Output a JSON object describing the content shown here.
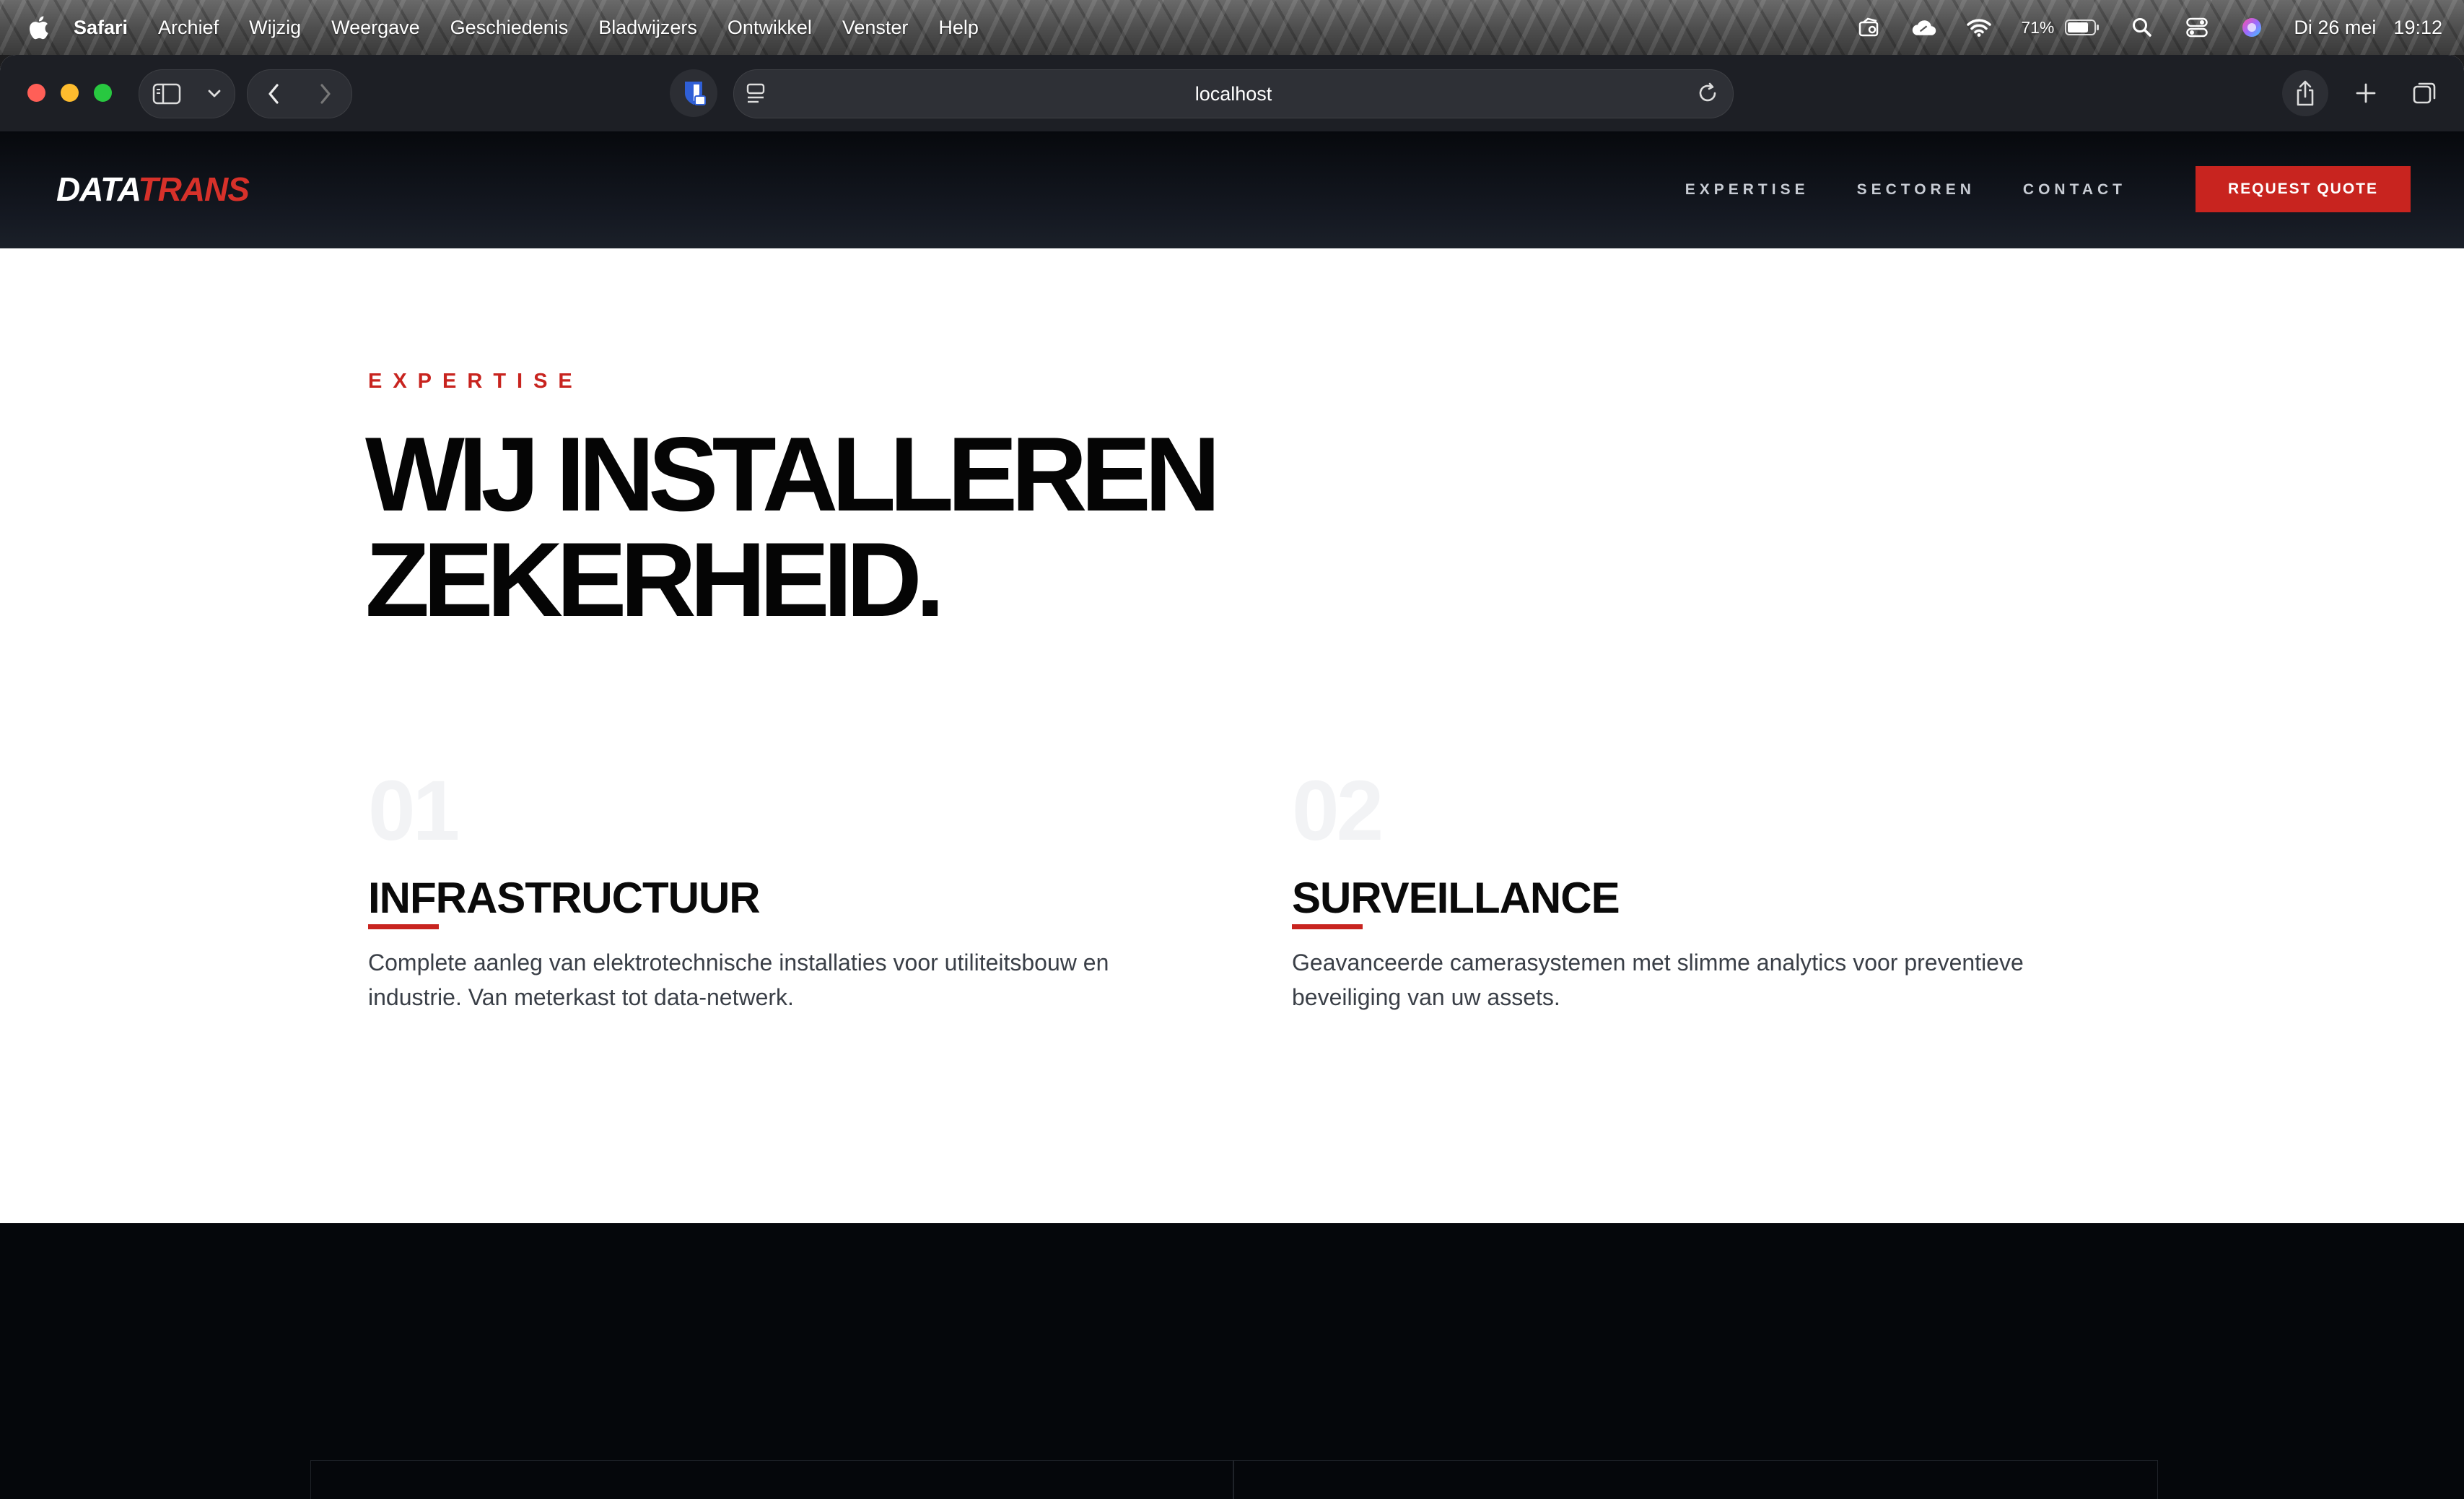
{
  "menubar": {
    "app_name": "Safari",
    "items": [
      "Archief",
      "Wijzig",
      "Weergave",
      "Geschiedenis",
      "Bladwijzers",
      "Ontwikkel",
      "Venster",
      "Help"
    ],
    "battery": "71%",
    "date": "Di 26 mei",
    "time": "19:12"
  },
  "browser": {
    "url": "localhost"
  },
  "site": {
    "logo_part1": "DATA",
    "logo_part2": "TRANS",
    "nav": [
      "EXPERTISE",
      "SECTOREN",
      "CONTACT"
    ],
    "cta": "REQUEST QUOTE",
    "colors": {
      "accent": "#c8241f",
      "dark": "#05070b",
      "header": "#141821"
    }
  },
  "expertise": {
    "eyebrow": "EXPERTISE",
    "headline_line1": "WIJ INSTALLEREN",
    "headline_line2": "ZEKERHEID.",
    "cards": [
      {
        "number": "01",
        "title": "INFRASTRUCTUUR",
        "description": "Complete aanleg van elektrotechnische installaties voor utiliteitsbouw en industrie. Van meterkast tot data-netwerk."
      },
      {
        "number": "02",
        "title": "SURVEILLANCE",
        "description": "Geavanceerde camerasystemen met slimme analytics voor preventieve beveiliging van uw assets."
      }
    ]
  }
}
